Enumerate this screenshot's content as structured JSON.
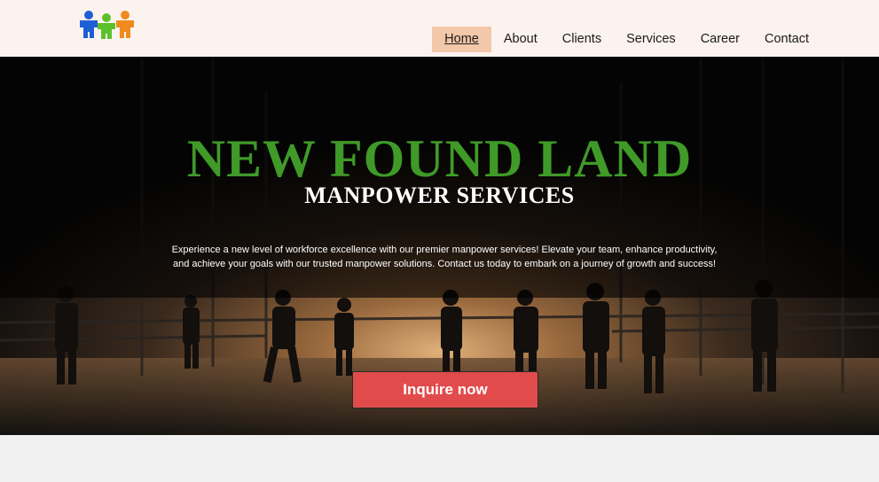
{
  "header": {
    "logo_icon": "puzzle-people-logo",
    "colors": {
      "background": "#fdf3ee",
      "active_tab": "#f3c7aa"
    }
  },
  "nav": {
    "items": [
      {
        "label": "Home",
        "active": true
      },
      {
        "label": "About",
        "active": false
      },
      {
        "label": "Clients",
        "active": false
      },
      {
        "label": "Services",
        "active": false
      },
      {
        "label": "Career",
        "active": false
      },
      {
        "label": "Contact",
        "active": false
      }
    ]
  },
  "hero": {
    "title": "NEW FOUND LAND",
    "subtitle": "MANPOWER SERVICES",
    "description": "Experience a new level of workforce excellence with our premier manpower services! Elevate your team, enhance productivity, and achieve your goals with our trusted manpower solutions. Contact us today to embark on a journey of growth and success!",
    "cta_label": "Inquire now",
    "colors": {
      "title": "#3f9a28",
      "cta": "#e24b4b"
    }
  }
}
